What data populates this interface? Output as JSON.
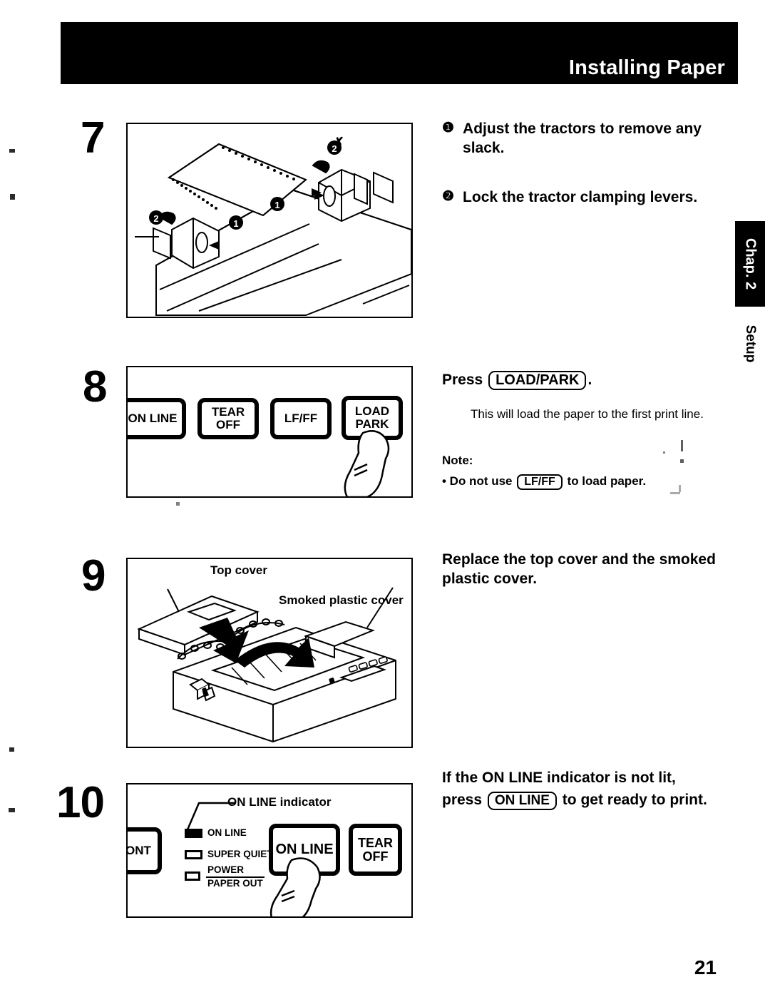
{
  "header": {
    "title": "Installing Paper"
  },
  "side_tab": {
    "chapter": "Chap. 2",
    "section": "Setup"
  },
  "page_number": "21",
  "steps": [
    {
      "number": "7",
      "instructions": [
        {
          "marker": "❶",
          "text": "Adjust the tractors to remove any slack."
        },
        {
          "marker": "❷",
          "text": "Lock the tractor clamping levers."
        }
      ],
      "figure": {
        "name": "tractor-adjustment-illustration",
        "markers": [
          "❶",
          "❶",
          "❷",
          "❷"
        ]
      }
    },
    {
      "number": "8",
      "instruction_prefix": "Press",
      "instruction_key": "LOAD/PARK",
      "instruction_suffix": ".",
      "body": "This will load the paper to the first print line.",
      "note_label": "Note:",
      "note_prefix": "• Do not use",
      "note_key": "LF/FF",
      "note_suffix": "to load paper.",
      "figure": {
        "name": "control-panel-load-park-illustration",
        "buttons": [
          {
            "lines": [
              "ON LINE"
            ]
          },
          {
            "lines": [
              "TEAR",
              "OFF"
            ]
          },
          {
            "lines": [
              "LF/FF"
            ]
          },
          {
            "lines": [
              "LOAD",
              "PARK"
            ]
          }
        ]
      }
    },
    {
      "number": "9",
      "instruction": "Replace the top cover and the smoked plastic cover.",
      "figure": {
        "name": "replace-covers-illustration",
        "labels": [
          "Top cover",
          "Smoked plastic cover"
        ]
      }
    },
    {
      "number": "10",
      "instruction_line1_prefix": "If the",
      "instruction_line1_bold": "ON LINE",
      "instruction_line1_suffix": "indicator is not lit,",
      "instruction_line2_prefix": "press",
      "instruction_line2_key": "ON LINE",
      "instruction_line2_suffix": "to get ready to print.",
      "figure": {
        "name": "on-line-indicator-illustration",
        "callout": "ON LINE indicator",
        "leds": [
          {
            "label": "ON LINE",
            "state": "on"
          },
          {
            "label": "SUPER QUIET",
            "state": "off"
          },
          {
            "label_top": "POWER",
            "label_bottom": "PAPER OUT",
            "state": "off"
          }
        ],
        "buttons": [
          {
            "lines": [
              "ONT"
            ]
          },
          {
            "lines": [
              "ON LINE"
            ]
          },
          {
            "lines": [
              "TEAR",
              "OFF"
            ]
          }
        ]
      }
    }
  ],
  "colors": {
    "ink": "#000000",
    "paper": "#ffffff"
  }
}
